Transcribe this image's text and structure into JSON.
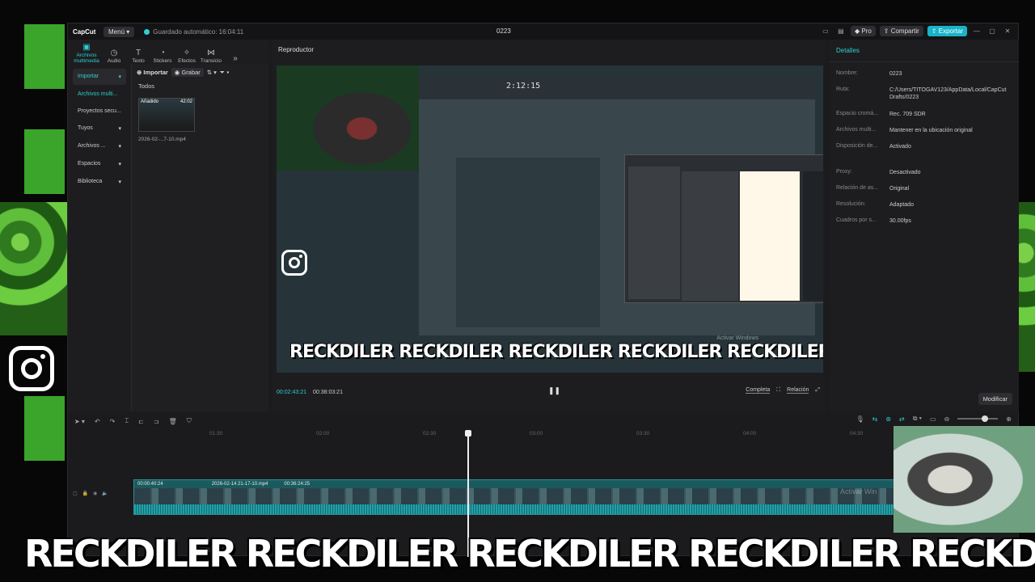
{
  "window": {
    "app_name": "CapCut",
    "menu_label": "Menú",
    "autosave": "Guardado automático: 16:04:11",
    "project_title": "0223",
    "pro_label": "Pro",
    "share_label": "Compartir",
    "export_label": "Exportar"
  },
  "toolbar": {
    "tools": [
      {
        "label": "Archivos multimedia",
        "icon": "media-icon"
      },
      {
        "label": "Audio",
        "icon": "audio-icon"
      },
      {
        "label": "Texto",
        "icon": "text-icon"
      },
      {
        "label": "Stickers",
        "icon": "sticker-icon"
      },
      {
        "label": "Efectos",
        "icon": "effects-icon"
      },
      {
        "label": "Transicio",
        "icon": "transition-icon"
      }
    ]
  },
  "sidebar": {
    "items": [
      {
        "label": "Importar"
      },
      {
        "label": "Archivos multi..."
      },
      {
        "label": "Proyectos secu..."
      },
      {
        "label": "Tuyos"
      },
      {
        "label": "Archivos ..."
      },
      {
        "label": "Espacios"
      },
      {
        "label": "Biblioteca"
      }
    ]
  },
  "media": {
    "import_label": "Importar",
    "record_label": "Grabar",
    "filter_label": "Todos",
    "thumb_added": "Añadido",
    "thumb_duration": "42:02",
    "thumb_name": "2026-02-...7-10.mp4"
  },
  "player": {
    "header": "Reproductor",
    "fl_time": "2:12:15",
    "overlay_text": "RECKDILER RECKDILER RECKDILER RECKDILER RECKDILER",
    "watermark": "Activar Windows",
    "current_time": "00:02:43:21",
    "total_time": "00:38:03:21",
    "complete_label": "Completa",
    "ratio_label": "Relación"
  },
  "details": {
    "header": "Detalles",
    "rows": [
      {
        "k": "Nombre:",
        "v": "0223"
      },
      {
        "k": "Ruta:",
        "v": "C:/Users/TITOGAV123/AppData/Local/CapCut Drafts/0223"
      },
      {
        "k": "Espacio cromá...",
        "v": "Rec. 709 SDR"
      },
      {
        "k": "Archivos multi...",
        "v": "Mantener en la ubicación original"
      },
      {
        "k": "Disposición de...",
        "v": "Activado"
      },
      {
        "k": "Proxy:",
        "v": "Desactivado"
      },
      {
        "k": "Relación de as...",
        "v": "Original"
      },
      {
        "k": "Resolución:",
        "v": "Adaptado"
      },
      {
        "k": "Cuadros por s...",
        "v": "30.00fps"
      }
    ],
    "modify_label": "Modificar"
  },
  "timeline": {
    "ruler": [
      "01:30",
      "02:00",
      "02:30",
      "03:00",
      "03:30",
      "04:00",
      "04:30"
    ],
    "clip_start": "00:00:40:24",
    "clip_name": "2026-02-14 21-17-10.mp4",
    "clip_duration": "00:36:24:25",
    "watermark": "Activar Win"
  },
  "overlay": {
    "banner": "RECKDILER RECKDILER RECKDILER RECKDILER RECKDILER"
  },
  "colors": {
    "accent": "#2ecfd1",
    "export": "#18b3c8",
    "clip": "#1f6e72"
  }
}
